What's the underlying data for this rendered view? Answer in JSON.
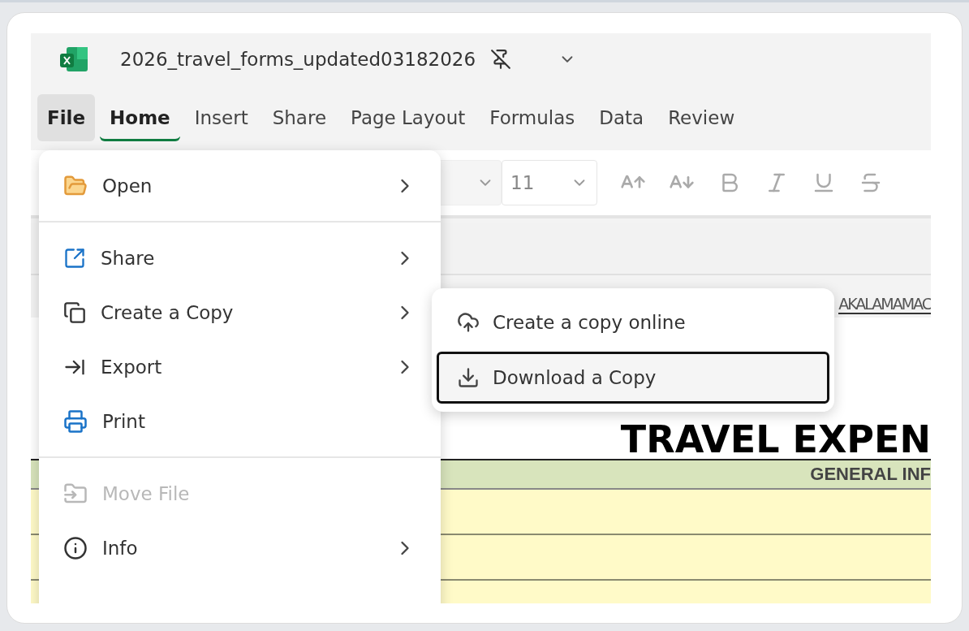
{
  "title_bar": {
    "file_name": "2026_travel_forms_updated03182026"
  },
  "tabs": [
    {
      "label": "File",
      "selected": false,
      "open": true
    },
    {
      "label": "Home",
      "selected": true,
      "open": false
    },
    {
      "label": "Insert",
      "selected": false,
      "open": false
    },
    {
      "label": "Share",
      "selected": false,
      "open": false
    },
    {
      "label": "Page Layout",
      "selected": false,
      "open": false
    },
    {
      "label": "Formulas",
      "selected": false,
      "open": false
    },
    {
      "label": "Data",
      "selected": false,
      "open": false
    },
    {
      "label": "Review",
      "selected": false,
      "open": false
    }
  ],
  "ribbon": {
    "font_size": "11"
  },
  "column_headers": "AKALAMAMAC",
  "sheet": {
    "title": "TRAVEL EXPEN",
    "section_header": "GENERAL INF"
  },
  "file_menu": {
    "sections": [
      [
        {
          "label": "Open",
          "has_submenu": true,
          "disabled": false
        }
      ],
      [
        {
          "label": "Share",
          "has_submenu": true,
          "disabled": false
        },
        {
          "label": "Create a Copy",
          "has_submenu": true,
          "disabled": false
        },
        {
          "label": "Export",
          "has_submenu": true,
          "disabled": false
        },
        {
          "label": "Print",
          "has_submenu": false,
          "disabled": false
        }
      ],
      [
        {
          "label": "Move File",
          "has_submenu": false,
          "disabled": true
        },
        {
          "label": "Info",
          "has_submenu": true,
          "disabled": false
        }
      ]
    ]
  },
  "submenu": {
    "items": [
      {
        "label": "Create a copy online",
        "focused": false
      },
      {
        "label": "Download a Copy",
        "focused": true
      }
    ]
  }
}
